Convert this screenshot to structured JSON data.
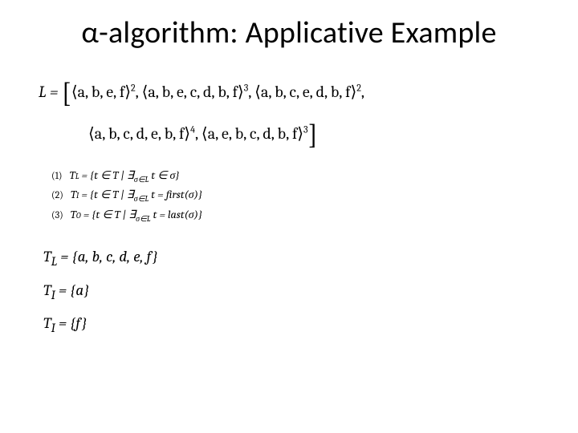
{
  "title": "α-algorithm: Applicative Example",
  "log": {
    "prefix": "L  = ",
    "traces": [
      {
        "seq": "⟨a, b, e, f⟩",
        "exp": "2"
      },
      {
        "seq": "⟨a, b, e, c, d, b, f⟩",
        "exp": "3"
      },
      {
        "seq": "⟨a, b, c, e, d, b, f⟩",
        "exp": "2"
      },
      {
        "seq": "⟨a, b, c, d, e, b, f⟩",
        "exp": "4"
      },
      {
        "seq": "⟨a, e, b, c, d, b, f⟩",
        "exp": "3"
      }
    ]
  },
  "steps": {
    "s1": {
      "n": "(1)",
      "lhs": "T",
      "sub": "L",
      "body": " = {t ∈ T | ∃",
      "esub": "σ∈L",
      "tail": " t ∈ σ}"
    },
    "s2": {
      "n": "(2)",
      "lhs": "T",
      "sub": "I",
      "body": " = {t ∈ T | ∃",
      "esub": "σ∈L",
      "tail": " t = first(σ)}"
    },
    "s3": {
      "n": "(3)",
      "lhs": "T",
      "sub": "O",
      "body": " = {t ∈ T | ∃",
      "esub": "σ∈L",
      "tail": " t = last(σ)}"
    }
  },
  "results": {
    "tl": {
      "lhs": "T",
      "sub": "L",
      "rhs": " = {a, b, c, d, e, f}"
    },
    "ti": {
      "lhs": "T",
      "sub": "I",
      "rhs": " = {a}"
    },
    "to": {
      "lhs": "T",
      "sub": "I",
      "rhs": " = {f}"
    }
  }
}
